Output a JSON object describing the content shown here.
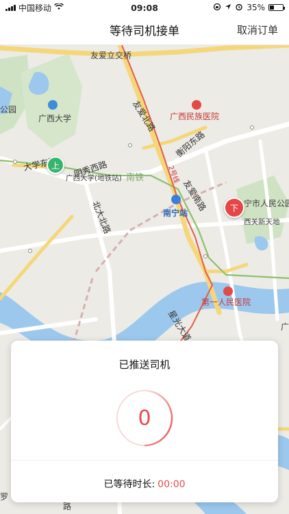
{
  "status_bar": {
    "carrier": "中国移动",
    "time": "09:08",
    "battery": "35%",
    "battery_level": 0.35
  },
  "nav": {
    "title": "等待司机接单",
    "cancel_label": "取消订单"
  },
  "map": {
    "labels": {
      "friendship_bridge": "友爱立交桥",
      "gx_university": "广西大学",
      "gx_ethnic_hospital": "广西民族医院",
      "youai_north": "友爱北路",
      "hengyang_east": "衡阳东路",
      "line2": "2号线",
      "mingxiu_west": "明秀西路",
      "daxue_east": "大学东路",
      "gx_university_station": "广西大学(地铁站)",
      "nantie": "南铁",
      "youai_south": "友爱南路",
      "people_park": "宁市人民公园",
      "nanning_station": "南宁站",
      "xiguan": "西关新天地",
      "beida_north": "北大北路",
      "first_hospital": "第一人民医院",
      "huangguang_ave": "星光大道",
      "park_left": "公园",
      "guang_right": "广子",
      "bottom_left": "罗",
      "bottom_road": "路"
    },
    "pickup_marker": "上",
    "dropoff_marker": "下"
  },
  "card": {
    "title": "已推送司机",
    "pushed_count": "0",
    "wait_label": "已等待时长:",
    "wait_time": "00:00"
  },
  "colors": {
    "accent_red": "#e84a4a",
    "pickup_green": "#36b56e",
    "river_blue": "#9cc8ee"
  }
}
